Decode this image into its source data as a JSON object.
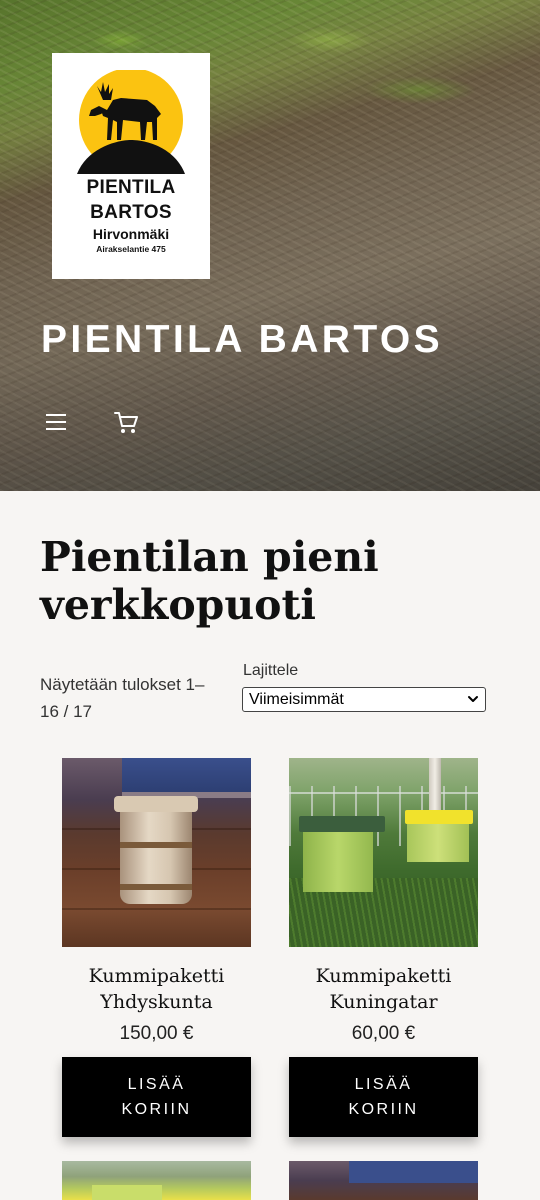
{
  "header": {
    "logo": {
      "line1": "PIENTILA",
      "line2": "BARTOS",
      "line3": "Hirvonmäki",
      "line4": "Airakselantie 475",
      "sun_color": "#FBC311"
    },
    "site_title": "PIENTILA BARTOS",
    "menu_icon": "hamburger-menu-icon",
    "cart_icon": "shopping-cart-icon"
  },
  "shop": {
    "title": "Pientilan pieni verkkopuoti",
    "result_count": "Näytetään tulokset 1–16 / 17",
    "sort": {
      "label": "Lajittele",
      "selected": "Viimeisimmät"
    }
  },
  "products": [
    {
      "name": "Kummipaketti Yhdyskunta",
      "price": "150,00 €",
      "button_line1": "LISÄÄ",
      "button_line2": "KORIIN"
    },
    {
      "name": "Kummipaketti Kuningatar",
      "price": "60,00 €",
      "button_line1": "LISÄÄ",
      "button_line2": "KORIIN"
    }
  ],
  "colors": {
    "background": "#f7f5f3",
    "button": "#000000",
    "button_text": "#ffffff",
    "hive_roof_yellow": "#F1E22C",
    "hive_roof_green": "#3B5E3D"
  }
}
